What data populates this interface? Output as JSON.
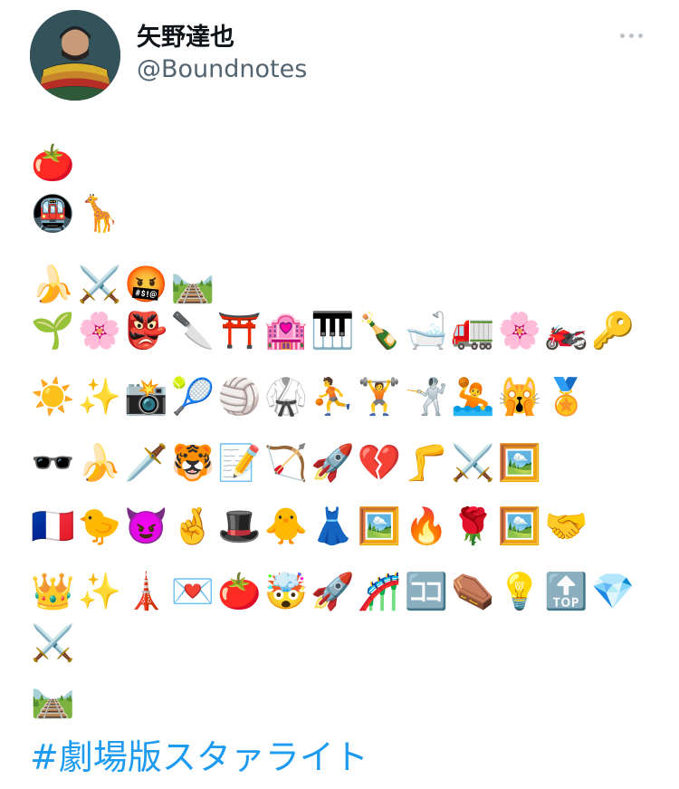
{
  "user": {
    "display_name": "矢野達也",
    "handle": "@Boundnotes"
  },
  "tweet": {
    "lines": [
      "🍅",
      "🚇🦒",
      "🍌⚔🤬🛤",
      "🌱🌸👺🔪⛩🏩🎹🍾🛁🚛🌸🏍🔑",
      "☀✨📸🎾🏐🥋⛹🏋🤺🤽🙀🏅",
      "🕶🍌🗡🐯📝🏹🚀💔🦵⚔🖼",
      "🇫🇷🐤😈🤞🎩🐥👗🖼🔥🌹🖼🤝",
      "👑✨🗼💌🍅🤯🚀🎢🈁⚰💡🔝💎",
      "⚔",
      "🛤"
    ],
    "hashtag": "#劇場版スタァライト"
  },
  "icons": {
    "more": "more-horizontal-icon",
    "avatar": "profile-photo"
  },
  "colors": {
    "text": "#0f1419",
    "secondary_text": "#536471",
    "link": "#1d9bf0",
    "more_dots": "#b9c2ca"
  }
}
